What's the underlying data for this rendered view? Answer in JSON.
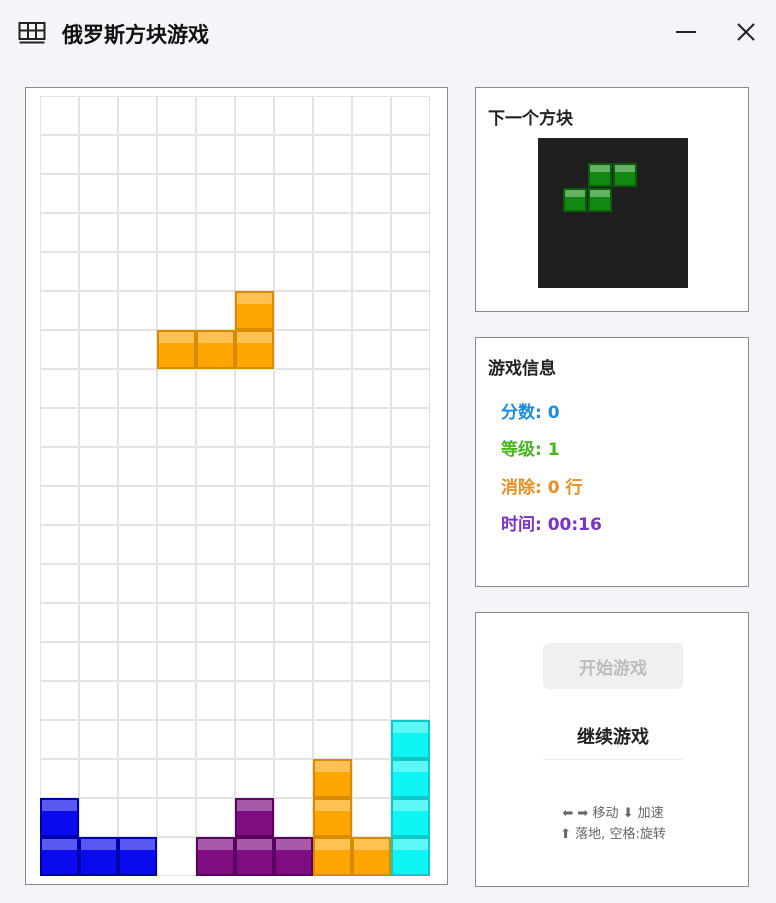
{
  "window": {
    "title": "俄罗斯方块游戏",
    "icons": {
      "app": "grid-icon",
      "minimize": "minimize-icon",
      "close": "close-icon"
    }
  },
  "board": {
    "cols": 10,
    "rows": 20,
    "colors": {
      "blue": {
        "fill": "#0a0aee",
        "border": "#0000aa"
      },
      "purple": {
        "fill": "#7e0d82",
        "border": "#5c0060"
      },
      "orange": {
        "fill": "#ffa500",
        "border": "#d98b00"
      },
      "cyan": {
        "fill": "#0ff5f5",
        "border": "#10c8c8"
      }
    },
    "falling_piece": {
      "color": "orange",
      "cells": [
        [
          5,
          5
        ],
        [
          3,
          6
        ],
        [
          4,
          6
        ],
        [
          5,
          6
        ]
      ]
    },
    "settled_cells": [
      {
        "col": 0,
        "row": 18,
        "color": "blue"
      },
      {
        "col": 0,
        "row": 19,
        "color": "blue"
      },
      {
        "col": 1,
        "row": 19,
        "color": "blue"
      },
      {
        "col": 2,
        "row": 19,
        "color": "blue"
      },
      {
        "col": 4,
        "row": 19,
        "color": "purple"
      },
      {
        "col": 5,
        "row": 18,
        "color": "purple"
      },
      {
        "col": 5,
        "row": 19,
        "color": "purple"
      },
      {
        "col": 6,
        "row": 19,
        "color": "purple"
      },
      {
        "col": 7,
        "row": 17,
        "color": "orange"
      },
      {
        "col": 7,
        "row": 18,
        "color": "orange"
      },
      {
        "col": 7,
        "row": 19,
        "color": "orange"
      },
      {
        "col": 8,
        "row": 19,
        "color": "orange"
      },
      {
        "col": 9,
        "row": 16,
        "color": "cyan"
      },
      {
        "col": 9,
        "row": 17,
        "color": "cyan"
      },
      {
        "col": 9,
        "row": 18,
        "color": "cyan"
      },
      {
        "col": 9,
        "row": 19,
        "color": "cyan"
      }
    ]
  },
  "next_panel": {
    "title": "下一个方块",
    "piece_color": "#118811",
    "piece_cells": [
      [
        2,
        1
      ],
      [
        3,
        1
      ],
      [
        1,
        2
      ],
      [
        2,
        2
      ]
    ]
  },
  "info_panel": {
    "title": "游戏信息",
    "score": {
      "label": "分数",
      "value": "0",
      "color": "#1a8be8"
    },
    "level": {
      "label": "等级",
      "value": "1",
      "color": "#45b81e"
    },
    "lines": {
      "label": "消除",
      "value": "0 行",
      "color": "#f08c1e"
    },
    "time": {
      "label": "时间",
      "value": "00:16",
      "color": "#7a32c8"
    }
  },
  "control_panel": {
    "start_label": "开始游戏",
    "resume_label": "继续游戏",
    "help_line1": "⬅ ➡ 移动  ⬇ 加速",
    "help_line2": "⬆ 落地,  空格:旋转"
  }
}
